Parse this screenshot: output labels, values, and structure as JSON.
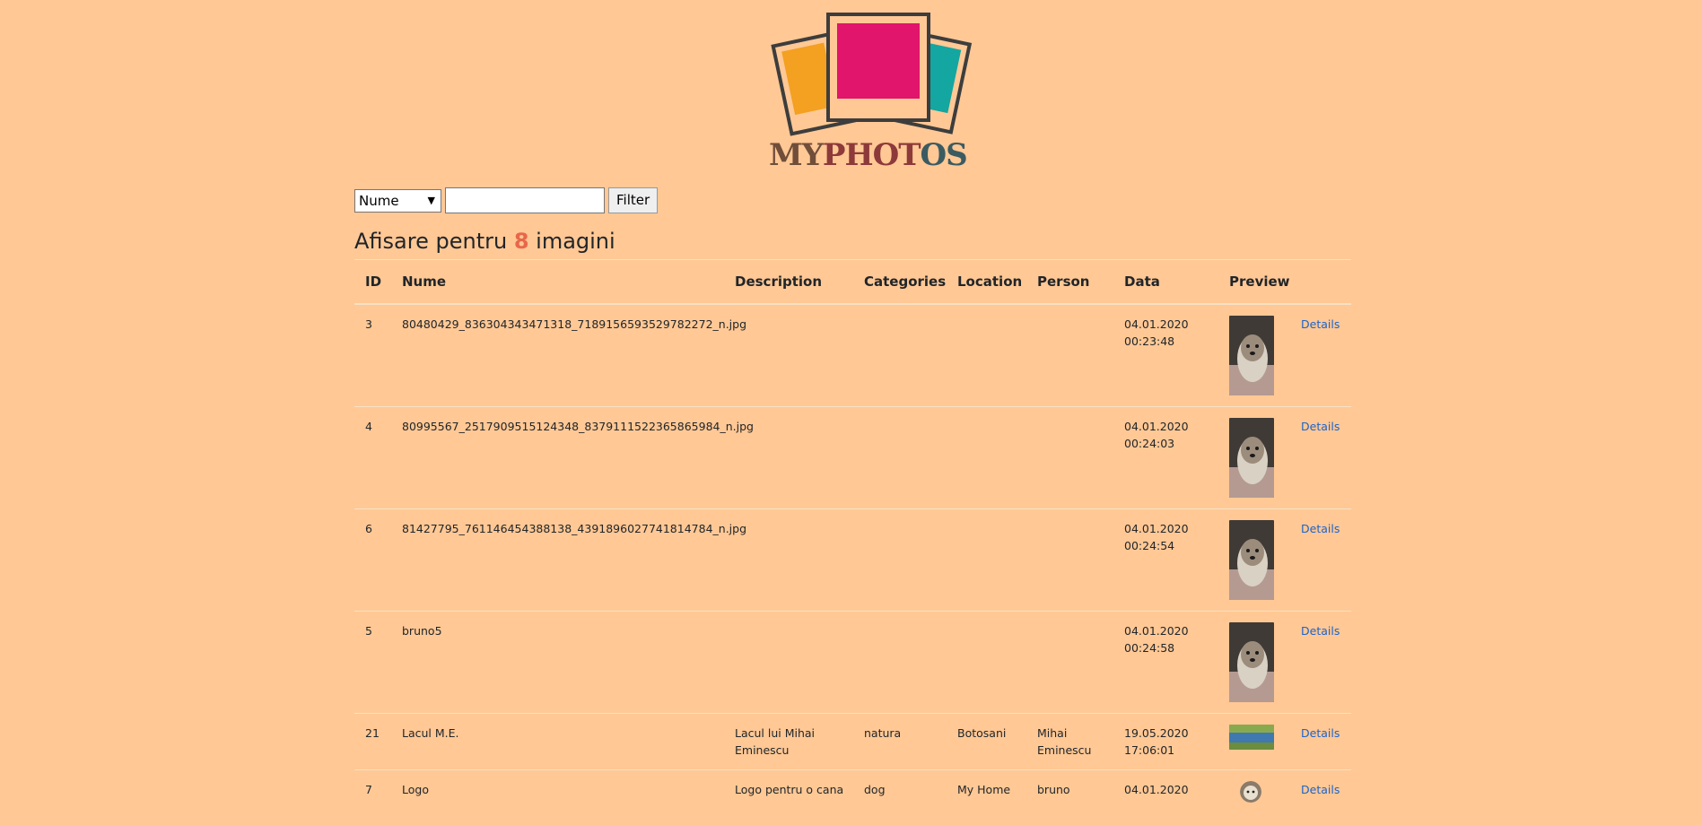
{
  "logo": {
    "parts": [
      "MY",
      "PHOT",
      "OS"
    ],
    "colors": [
      "#704e3a",
      "#8d3a3a",
      "#3b5b61"
    ]
  },
  "filter": {
    "select_value": "Nume",
    "input_value": "",
    "button_label": "Filter"
  },
  "heading": {
    "prefix": "Afisare pentru ",
    "count": "8",
    "suffix": " imagini"
  },
  "table": {
    "columns": [
      "ID",
      "Nume",
      "Description",
      "Categories",
      "Location",
      "Person",
      "Data",
      "Preview"
    ],
    "rows": [
      {
        "id": "3",
        "nume": "80480429_836304343471318_7189156593529782272_n.jpg",
        "description": "",
        "categories": "",
        "location": "",
        "person": "",
        "date": "04.01.2020",
        "time": "00:23:48",
        "details": "Details",
        "thumb": "dog"
      },
      {
        "id": "4",
        "nume": "80995567_2517909515124348_8379111522365865984_n.jpg",
        "description": "",
        "categories": "",
        "location": "",
        "person": "",
        "date": "04.01.2020",
        "time": "00:24:03",
        "details": "Details",
        "thumb": "dog"
      },
      {
        "id": "6",
        "nume": "81427795_761146454388138_4391896027741814784_n.jpg",
        "description": "",
        "categories": "",
        "location": "",
        "person": "",
        "date": "04.01.2020",
        "time": "00:24:54",
        "details": "Details",
        "thumb": "dog"
      },
      {
        "id": "5",
        "nume": "bruno5",
        "description": "",
        "categories": "",
        "location": "",
        "person": "",
        "date": "04.01.2020",
        "time": "00:24:58",
        "details": "Details",
        "thumb": "dog"
      },
      {
        "id": "21",
        "nume": "Lacul M.E.",
        "description": "Lacul lui Mihai Eminescu",
        "categories": "natura",
        "location": "Botosani",
        "person": "Mihai Eminescu",
        "date": "19.05.2020",
        "time": "17:06:01",
        "details": "Details",
        "thumb": "lake"
      },
      {
        "id": "7",
        "nume": "Logo",
        "description": "Logo pentru o cana",
        "categories": "dog",
        "location": "My Home",
        "person": "bruno",
        "date": "04.01.2020",
        "time": "",
        "details": "Details",
        "thumb": "logo"
      }
    ]
  }
}
